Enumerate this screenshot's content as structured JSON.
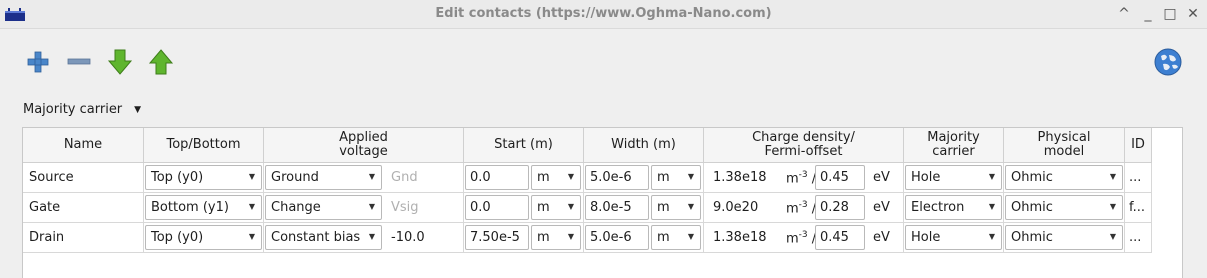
{
  "window": {
    "title": "Edit contacts (https://www.Oghma-Nano.com)",
    "buttons": [
      "^",
      "_",
      "□",
      "✕"
    ]
  },
  "toolbar": {
    "add_icon": "plus-icon",
    "remove_icon": "minus-icon",
    "move_down_icon": "arrow-down-icon",
    "move_up_icon": "arrow-up-icon",
    "help_icon": "globe-icon"
  },
  "majority_button": {
    "label": "Majority carrier"
  },
  "table": {
    "headers": [
      "Name",
      "Top/Bottom",
      "Applied\nvoltage",
      "Start (m)",
      "Width (m)",
      "Charge density/\nFermi-offset",
      "Majority\ncarrier",
      "Physical\nmodel",
      "ID"
    ],
    "unit_density": "m",
    "unit_density_exp": "-3",
    "unit_density_sep": "/",
    "unit_energy": "eV",
    "rows": [
      {
        "name": "Source",
        "position": "Top (y0)",
        "voltage_mode": "Ground",
        "voltage_value": "Gnd",
        "voltage_dim": true,
        "start": "0.0",
        "start_unit": "m",
        "width": "5.0e-6",
        "width_unit": "m",
        "density": "1.38e18",
        "fermi": "0.45",
        "carrier": "Hole",
        "model": "Ohmic",
        "id": "..."
      },
      {
        "name": "Gate",
        "position": "Bottom (y1)",
        "voltage_mode": "Change",
        "voltage_value": "Vsig",
        "voltage_dim": true,
        "start": "0.0",
        "start_unit": "m",
        "width": "8.0e-5",
        "width_unit": "m",
        "density": "9.0e20",
        "fermi": "0.28",
        "carrier": "Electron",
        "model": "Ohmic",
        "id": "f..."
      },
      {
        "name": "Drain",
        "position": "Top (y0)",
        "voltage_mode": "Constant bias",
        "voltage_value": "-10.0",
        "voltage_dim": false,
        "start": "7.50e-5",
        "start_unit": "m",
        "width": "5.0e-6",
        "width_unit": "m",
        "density": "1.38e18",
        "fermi": "0.45",
        "carrier": "Hole",
        "model": "Ohmic",
        "id": "..."
      }
    ]
  }
}
